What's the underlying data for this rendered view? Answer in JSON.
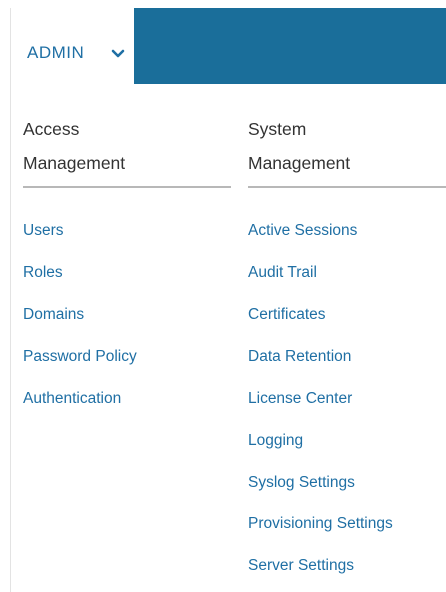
{
  "header": {
    "admin_label": "ADMIN",
    "chevron_icon": "chevron-down-icon",
    "accent_color": "#1a6e9a",
    "link_color": "#1f6fa4"
  },
  "columns": {
    "access": {
      "heading_line1": "Access",
      "heading_line2": "Management",
      "items": [
        "Users",
        "Roles",
        "Domains",
        "Password Policy",
        "Authentication"
      ]
    },
    "system": {
      "heading_line1": "System",
      "heading_line2": "Management",
      "items": [
        "Active Sessions",
        "Audit Trail",
        "Certificates",
        "Data Retention",
        "License Center",
        "Logging",
        "Syslog Settings",
        "Provisioning Settings",
        "Server Settings"
      ]
    }
  }
}
